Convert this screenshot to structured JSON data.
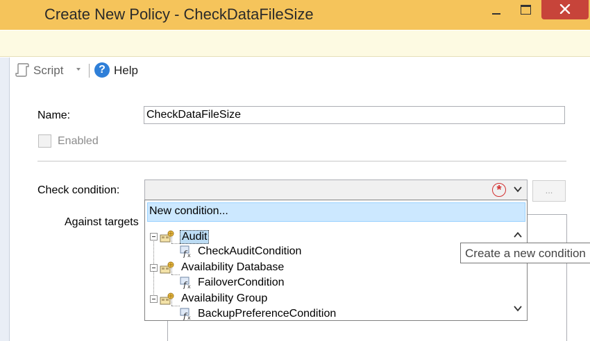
{
  "window": {
    "title": "Create New Policy - CheckDataFileSize"
  },
  "toolbar": {
    "script_label": "Script",
    "help_label": "Help"
  },
  "form": {
    "name_label": "Name:",
    "name_value": "CheckDataFileSize",
    "enabled_label": "Enabled",
    "enabled_checked": false,
    "check_condition_label": "Check condition:",
    "check_condition_value": "",
    "against_targets_label": "Against targets",
    "browse_button_label": "..."
  },
  "dropdown": {
    "new_condition_label": "New condition...",
    "tree": [
      {
        "facet": "Audit",
        "selected": true,
        "condition": "CheckAuditCondition"
      },
      {
        "facet": "Availability Database",
        "selected": false,
        "condition": "FailoverCondition"
      },
      {
        "facet": "Availability Group",
        "selected": false,
        "condition": "BackupPreferenceCondition"
      }
    ]
  },
  "tooltip": {
    "text": "Create a new condition"
  },
  "icons": {
    "script": "script-icon",
    "help": "help-icon",
    "error": "error-icon",
    "facet": "facet-icon",
    "condition": "condition-icon"
  },
  "colors": {
    "title_bar": "#f5c45b",
    "close_button": "#c7443a",
    "info_bar": "#fdfae2",
    "selection": "#cce8ff",
    "error": "#d32f2f",
    "help": "#2f7fd8"
  }
}
